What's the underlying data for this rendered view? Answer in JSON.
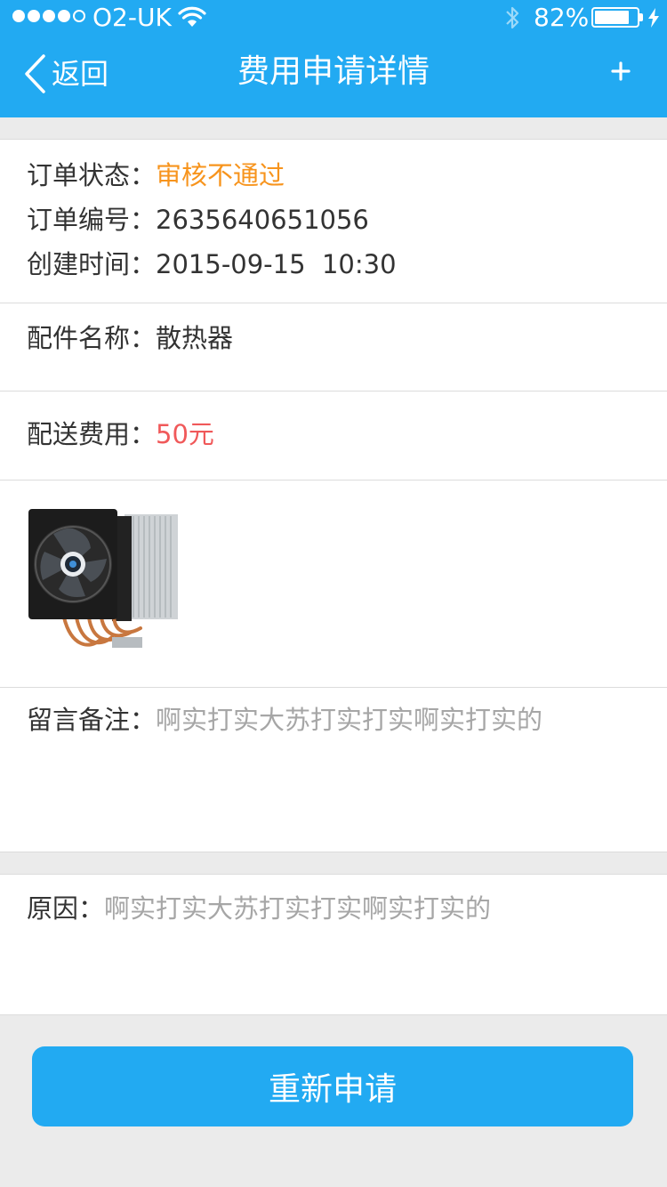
{
  "status_bar": {
    "carrier": "O2-UK",
    "battery_percent_label": "82%",
    "battery_level": 0.82,
    "signal_bars_filled": 4,
    "signal_bars_total": 5
  },
  "nav": {
    "back_label": "返回",
    "title": "费用申请详情",
    "add_icon": "plus-icon"
  },
  "order": {
    "status_label": "订单状态：",
    "status_value": "审核不通过",
    "number_label": "订单编号：",
    "number_value": "2635640651056",
    "created_label": "创建时间：",
    "created_value": "2015-09-15  10:30"
  },
  "part": {
    "name_label": "配件名称：",
    "name_value": "散热器"
  },
  "delivery": {
    "fee_label": "配送费用：",
    "fee_value": "50元"
  },
  "remark": {
    "label": "留言备注：",
    "value": "啊实打实大苏打实打实啊实打实的"
  },
  "reason": {
    "label": "原因：",
    "value": "啊实打实大苏打实打实啊实打实的"
  },
  "actions": {
    "reapply_label": "重新申请"
  },
  "colors": {
    "primary": "#22aaf2",
    "status_rejected": "#f7941d",
    "price": "#f0595a",
    "muted": "#a6a6a6"
  }
}
